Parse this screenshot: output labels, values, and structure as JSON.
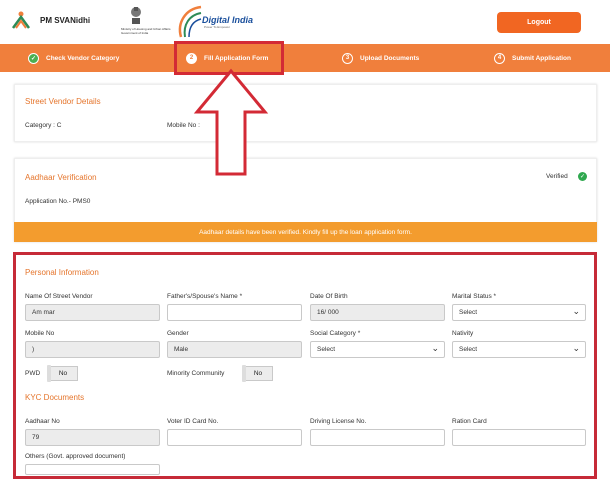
{
  "header": {
    "brand": "PM SVANidhi",
    "ministry": "Ministry of Housing and Urban Affairs Government of India",
    "digital_india": "Digital India",
    "digital_india_sub": "Power To Empower",
    "logout_label": "Logout"
  },
  "steps": [
    {
      "num": "✓",
      "label": "Check Vendor Category"
    },
    {
      "num": "2",
      "label": "Fill Application Form"
    },
    {
      "num": "3",
      "label": "Upload Documents"
    },
    {
      "num": "4",
      "label": "Submit Application"
    }
  ],
  "vendor_details": {
    "title": "Street Vendor Details",
    "category": "Category : C",
    "mobile": "Mobile No :"
  },
  "aadhaar": {
    "title": "Aadhaar Verification",
    "status": "Verified",
    "application_no": "Application No.- PMS0",
    "banner": "Aadhaar details have been verified. Kindly fill up the loan application form."
  },
  "personal": {
    "title": "Personal Information",
    "name_label": "Name Of Street Vendor",
    "name_value": "Am      mar",
    "father_label": "Father's/Spouse's Name *",
    "dob_label": "Date Of Birth",
    "dob_value": "16/     000",
    "marital_label": "Marital Status *",
    "marital_value": "Select",
    "mobile_label": "Mobile No",
    "mobile_value": ")",
    "gender_label": "Gender",
    "gender_value": "Male",
    "social_label": "Social Category *",
    "social_value": "Select",
    "nativity_label": "Nativity",
    "nativity_value": "Select",
    "pwd_label": "PWD",
    "pwd_value": "No",
    "minority_label": "Minority Community",
    "minority_value": "No"
  },
  "kyc": {
    "title": "KYC Documents",
    "aadhaar_label": "Aadhaar No",
    "aadhaar_value": "79",
    "voter_label": "Voter ID Card No.",
    "driving_label": "Driving License No.",
    "ration_label": "Ration Card",
    "others_label": "Others (Govt. approved document)"
  },
  "colors": {
    "accent": "#f07f3c",
    "banner": "#f39c2e",
    "highlight": "#d32a35",
    "verified": "#2fa84f"
  }
}
